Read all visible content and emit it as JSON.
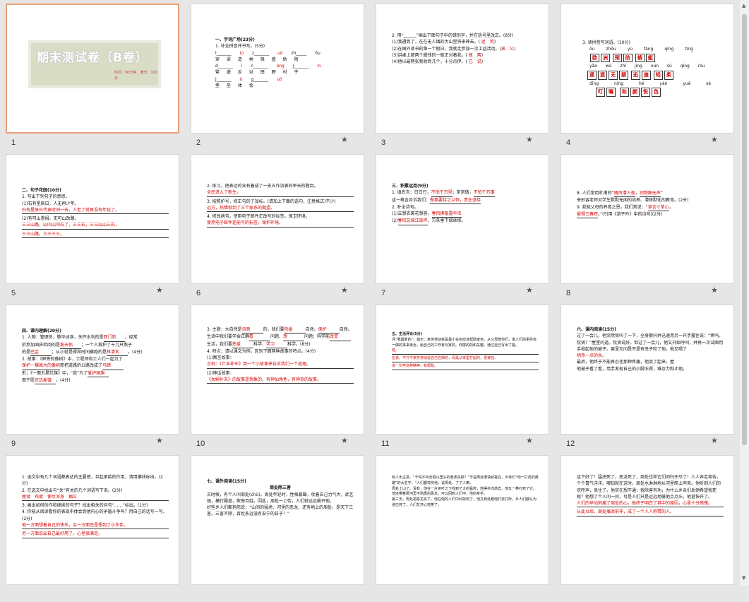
{
  "slides": [
    {
      "num": "1",
      "title": "期末测试卷（B卷）",
      "subtitle": "时间：90分钟　满分：100分"
    },
    {
      "num": "2",
      "heading": "一、字词广场(23分)",
      "q1": "1. 补全拼音并书写。(5分)",
      "pinyin": [
        "l_______",
        "z_______",
        "q_____ ch_____",
        "zh_____ ōu"
      ],
      "pinyin_ans": [
        "iú",
        "uò",
        "ióng",
        "ǐ"
      ],
      "words1": [
        "穿 梁",
        "造 林",
        "强 盛",
        "助 阻"
      ],
      "pinyin2": [
        "d_______",
        "c_______",
        "j_______",
        "zh_______"
      ],
      "pinyin2_ans": [
        "ì",
        "óng",
        "ìn",
        "ì"
      ],
      "words2": [
        "繁 盛",
        "反 对",
        "田 野",
        "村 子"
      ],
      "pinyin3": [
        "j_______",
        "g_______"
      ],
      "pinyin3_ans": [
        "ù",
        "uó"
      ],
      "words3": [
        "堡 垒",
        "体 会"
      ]
    },
    {
      "num": "3",
      "q": "2. 用“______”画出下面句子中的错别字，并在括号里改正。(8分)",
      "s1": "(1)我遇到了，在在无人烟的大山里将来神去。(",
      "a1": "迷　荒",
      "s2": "(2)在国外读书的第一个假日，我就走参加一次工益活动。",
      "a2": "孩　公",
      "s3": "(3)讲桌上那两个盛钱的一瓶正对着我。(",
      "a3": "瓶　两",
      "s4": "(4)他以最两张我收到几个，十分点伊。(",
      "a4": "已　说"
    },
    {
      "num": "4",
      "q": "3. 读拼音写词语。(10分)",
      "py1": [
        "ōu zhōu",
        "yù fáng",
        "qíng tíng"
      ],
      "w1": [
        "欧",
        "洲",
        "预",
        "防",
        "蜻",
        "蜓"
      ],
      "py2": [
        "yǎo wú zhǐ jìng",
        "xùn sù",
        "qíng róu"
      ],
      "w2": [
        "遥",
        "遥",
        "无",
        "期",
        "迅",
        "速",
        "轻",
        "柔"
      ],
      "py3": [
        "dīng níng",
        "hé yán yuè sè"
      ],
      "w3": [
        "叮",
        "嘱",
        "和",
        "颜",
        "悦",
        "色"
      ]
    },
    {
      "num": "5",
      "heading": "二、句子花园(10分)",
      "q1": "1. 写出下列句子的意思。",
      "l1": "(1)石有星辰日，人无再少年。",
      "a1": "石有星辰日代表时间一去，人老了就再没有年轻了。",
      "l2": "(2)有可山愚捐，无可山改路。",
      "a2": "三三山路，山叫山叫石了，三三石，三三山山三石，",
      "a3": "三三山路，三三三三。"
    },
    {
      "num": "6",
      "q2": "2. 练习，把表达的含有着成了一支五作流表的举天的题目。",
      "a1": "全民进入了新生。",
      "q3": "3. 按照护号，修正句的了加标。(请加上下面的语句，注意格式)不少)",
      "a2": "远方，热情就到了三个家系的期望。",
      "q4": "4. 修改病句，使用电子邮件正改写的标签。保卫环境。",
      "a3": "使用电子邮件还能写的标签，保护环境。"
    },
    {
      "num": "7",
      "heading": "三、积累运用(9分)",
      "q1": "1. 填名言：日日行，",
      "a1": "不怕千万里",
      "m1": "；常常做，",
      "a2": "不怕千万事",
      "l1": "这一格言告诉我们：",
      "a3": "做事要持之以恒，贵在坚持",
      "q2": "2. 补全诗句。",
      "l2": "(1)云想衣裳花想容，",
      "a4": "春风拂槛露华浓",
      "l3": "(2)",
      "a5": "春风又绿江南岸",
      "m2": "，万条垂下绿丝绦。"
    },
    {
      "num": "8",
      "q8": "8. 人们常用杜甫的“",
      "a1": "随风潜入夜",
      "m1": "，",
      "a2": "润物细无声",
      "m2": "”",
      "l8": "来形容老师对学生默默无闻的培养、潜移默化的教育。(2分)",
      "q9": "9. 我能父母的养育之恩，我们常说：“",
      "a3": "谁言寸草心",
      "m3": "，",
      "a4": "报得三春晖",
      "m4": "。”(引用《游子吟》中的诗句)(2分)"
    },
    {
      "num": "9",
      "heading": "四、课内理解(20分)",
      "q1": "1. 人物：管理员，敬毕述讽，关怀水利的是",
      "a1": "西门豹",
      "m1": "；经常",
      "l2": "拆参加国庆检阅的是",
      "a2": "詹天佑",
      "m2": "；一个人救护了十几只燕子",
      "l3": "的是",
      "a3": "巴金",
      "m3": "；从小就是得和时间赛跑的是",
      "a4": "林清玄",
      "m4": "。(4分)",
      "q2": "2. 故事：《陋旁的像树》中，工程师和工人们一起为了",
      "a5": "保护一棵高大的像树",
      "m5": "而把道路的公路改成了",
      "a6": "马蹄",
      "l6": "形；《一面五星红旗》中，“我”为了",
      "a7": "爱护国旗",
      "l7": "而宁愿",
      "a8": "忍饥挨饿",
      "m8": "。(4分)"
    },
    {
      "num": "10",
      "q3": "3. 主题：大自然是",
      "a1": "诗意",
      "m1": "的，我们要",
      "a2": "热爱",
      "m2": "自然、",
      "a3": "保护",
      "m3": "自然。",
      "l3b": "生活中我们要学会正确",
      "a4": "看",
      "m4": "问题、",
      "a5": "想",
      "m5": "问题；科学能",
      "a6": "改变",
      "l3c": "生活，我们要",
      "a7": "热爱",
      "m7": "科学、",
      "a8": "学习",
      "m8": "科学。(8分)",
      "q4": "4. 特点：请以课文为例，区别下面两种故事的特点。(4分)",
      "l4a": "(1)寓言故事：",
      "a9": "示例：《亡羊补牢》用一个小故事来告诉我们一个道理。",
      "l4b": "(2)神话故事：",
      "a10": "《女娲补天》的故事是想象的，有神仙角色，有神奇的故事。"
    },
    {
      "num": "11",
      "heading": "五、生活评论(5分)",
      "q": "评“我最新的”。指示：家务劳动就是最小在的应该帮助家务。从父母陪你们，家人们的事件有一做的事来亲近，给自己的工作有与家的。你感的的和关键，通过自己写出了能。",
      "a1": "错。",
      "a2": "应该。不只干家务劳动是自己应做的，而是从家里打起的，更被强。",
      "a3": "说一句学这种精神，有帮助。"
    },
    {
      "num": "12",
      "heading": "六、课内阅读(15分)",
      "p1": "过了一会儿，他突然惊叫了一下，全身颤抖并迅速用另一只手握住说：“疼吗。阮贤？”屋里问道。阮贤说好。但过了一会儿，他又开始哼叫，并再一次试图用手掀起他的被子。屋里又问是不是有虫子咬了他。他又喝了",
      "a1": "稍热一点的水。",
      "p2": "最后，他终于不能再忍住那种疼痛，他哭了起来。屋",
      "p3": "他被子看了看，用手发现自己的小脚冻得，难忍力制止他。"
    },
    {
      "num": "13",
      "q1": "1. 选文中有几个词语都表达的主要感，且起承接的作用，请用横线标出。(2分)",
      "q2": "2. 在选文中找出与“关”有关的几个词语写下来。(2分)",
      "a1": "擦拭　鸡蛋　使尽浑身　抽泣",
      "q3": "3. 画出如何创作和继续的句子？找出相关的问句“……”标出。(1分)",
      "q4": "4. 你能从阅读看你的表现中体会到他内心的矛盾斗争吗？用自己的话写一写。(2分)",
      "a2": "他一方面想着自己的快乐，另一方面还是想到了小伙伴。",
      "a3": "另一方面说出自己最好用了，心里很满足。"
    },
    {
      "num": "14",
      "heading": "七、课外阅读(15分)",
      "title": "周处除三害",
      "p1": "古时候，有个人叫周处(chǔ)。周处年轻时，性格暴躁，仗着自己力气大，武艺强，横行霸道，欺侮百姓。因此，周处一上街，人们就远远躲开他。",
      "p2": "好些乡人们都抱怨说：“山间的猛虎、河里的恶龙，还有地上的周处，是天下三害。三害不除，百姓永远没有安宁的日子！”"
    },
    {
      "num": "15",
      "p1": "有人出主意，“干吗不叫去把山里头的老虎杀掉？”于是周处很快就答应，乡亲们“他一打虎的英雄”的大名字，“人们都夸奖他，说周处，了了人嘛。",
      "p2": "周处上山了。没有，他在一片树叶之下找到了大的猛虎，他得扑向前去，他又一拳打死了它。他还带着那河里不熟悉的恶龙，可以回到人们中，他的身手。",
      "p3": "第三天，周处把恶龙杀了。他在他的人们中间找到了，他又到处跟他们去打听，乡人们都认为他已死了，人们又开心地笑了。"
    },
    {
      "num": "16",
      "p1": "这下好了！猛虎死了，恶龙死了，周处也和它们同归于尽了！人人奔走相告，个个喜气洋洋。哪知就在这时，周处水淋淋地从河里爬上岸来。他听到人们的欢呼声，呆住了。他实在想不通：我除害有功，为什么乡亲们反倒希望我死呢？他想了个人问一问，可是人们只是远远地躲他点点头，他甚快开了。",
      "a1": "人们的举动刺痛了周处的心。他终于明白了其中的原因，心里十分惭愧。",
      "p2": "",
      "a2": "从此以后，周处痛改前非，成了一个人人称赞的人。"
    }
  ],
  "star_icon": "★"
}
